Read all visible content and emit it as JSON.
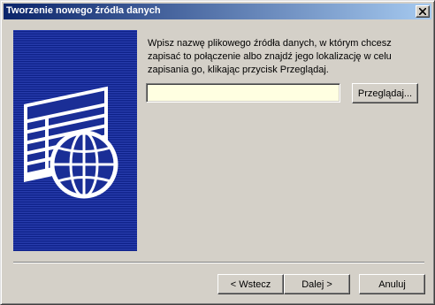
{
  "window": {
    "title": "Tworzenie nowego źródła danych",
    "close_label": "Zamknij"
  },
  "main": {
    "description": "Wpisz nazwę plikowego źródła danych, w którym chcesz zapisać to połączenie albo znajdź jego lokalizację w celu zapisania go, klikając przycisk Przeglądaj.",
    "file_input_value": "",
    "browse_label": "Przeglądaj...",
    "illustration_icon": "data-source-table-globe-icon"
  },
  "footer": {
    "back_label": "< Wstecz",
    "next_label": "Dalej >",
    "cancel_label": "Anuluj"
  }
}
